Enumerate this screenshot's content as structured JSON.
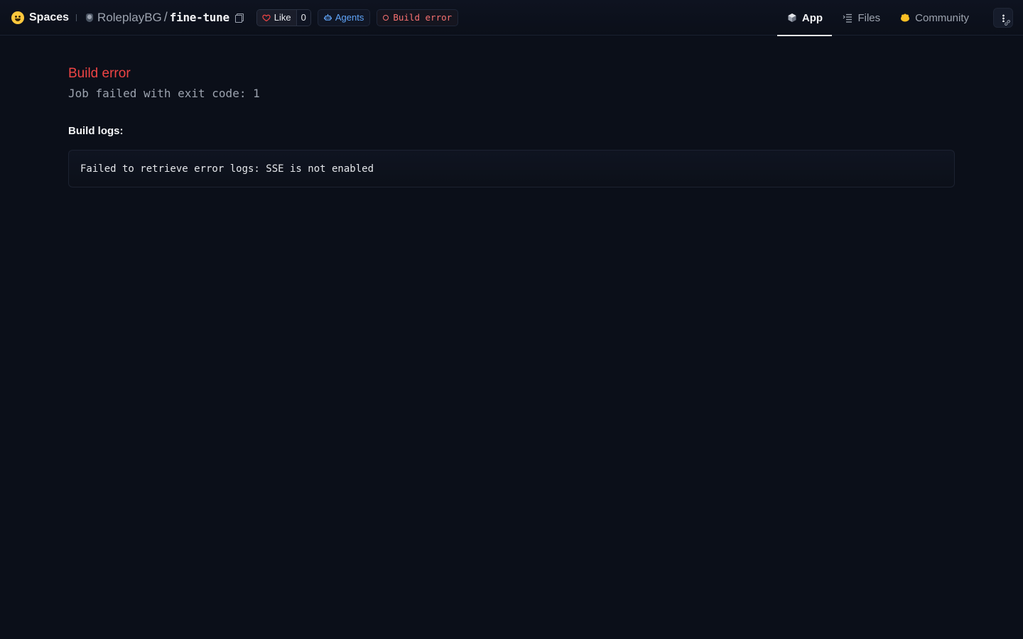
{
  "header": {
    "brand_label": "Spaces",
    "owner": "RoleplayBG",
    "separator": "/",
    "repo": "fine-tune",
    "like_label": "Like",
    "like_count": "0",
    "agents_label": "Agents",
    "status_label": "Build error",
    "tabs": [
      {
        "label": "App",
        "icon": "cube-icon",
        "active": true
      },
      {
        "label": "Files",
        "icon": "files-icon",
        "active": false
      },
      {
        "label": "Community",
        "icon": "community-icon",
        "active": false
      }
    ]
  },
  "main": {
    "error_title": "Build error",
    "error_message": "Job failed with exit code: 1",
    "logs_label": "Build logs:",
    "logs_text": "Failed to retrieve error logs: SSE is not enabled"
  },
  "colors": {
    "background": "#0b0f19",
    "error": "#ef4444",
    "accent_blue": "#60a5fa",
    "brand_yellow": "#ffc83d"
  }
}
